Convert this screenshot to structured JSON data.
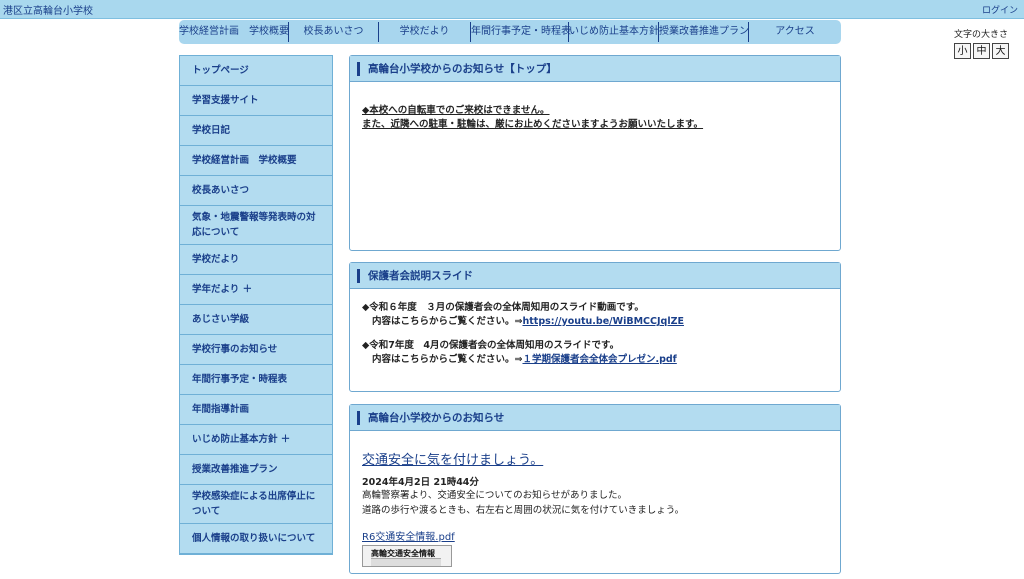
{
  "header": {
    "site_title": "港区立高輪台小学校",
    "login": "ログイン"
  },
  "global_nav": [
    "学校経営計画　学校概要",
    "校長あいさつ",
    "学校だより",
    "年間行事予定・時程表",
    "いじめ防止基本方針",
    "授業改善推進プラン",
    "アクセス"
  ],
  "font_size": {
    "label": "文字の大きさ",
    "small": "小",
    "medium": "中",
    "large": "大"
  },
  "sidebar": {
    "items": [
      "トップページ",
      "学習支援サイト",
      "学校日記",
      "学校経営計画　学校概要",
      "校長あいさつ",
      "気象・地震警報等発表時の対応について",
      "学校だより",
      "学年だより ＋",
      "あじさい学級",
      "学校行事のお知らせ",
      "年間行事予定・時程表",
      "年間指導計画",
      "いじめ防止基本方針 ＋",
      "授業改善推進プラン",
      "学校感染症による出席停止について",
      "個人情報の取り扱いについて"
    ]
  },
  "panels": {
    "top_notice": {
      "title": "高輪台小学校からのお知らせ【トップ】",
      "line1": "◆本校への自転車でのご来校はできません。",
      "line2": "また、近隣への駐車・駐輪は、厳にお止めくださいますようお願いいたします。"
    },
    "slides": {
      "title": "保護者会説明スライド",
      "item1_line1": "◆令和６年度　３月の保護者会の全体周知用のスライド動画です。",
      "item1_line2_prefix": "内容はこちらからご覧ください。⇒",
      "item1_link": "https://youtu.be/WiBMCCJqlZE",
      "item2_line1": "◆令和7年度　4月の保護者会の全体周知用のスライドです。",
      "item2_line2_prefix": "内容はこちらからご覧ください。⇒",
      "item2_link": "１学期保護者会全体会プレゼン.pdf"
    },
    "news": {
      "title": "高輪台小学校からのお知らせ",
      "article_title": "交通安全に気を付けましょう。",
      "article_date": "2024年4月2日 21時44分",
      "article_line1": "高輪警察署より、交通安全についてのお知らせがありました。",
      "article_line2": "道路の歩行や渡るときも、右左右と周囲の状況に気を付けていきましょう。",
      "attachment": "R6交通安全情報.pdf",
      "thumb_label": "高輪交通安全情報"
    }
  }
}
